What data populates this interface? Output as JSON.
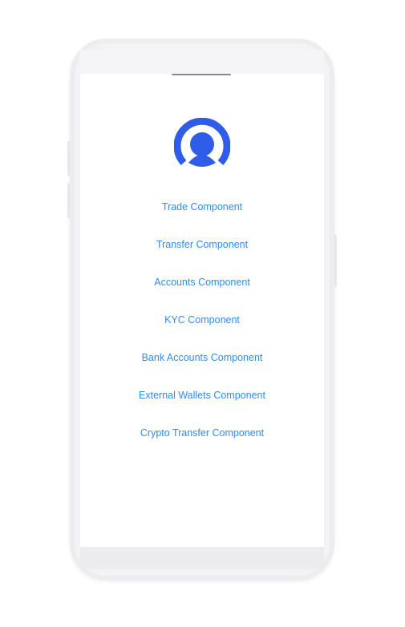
{
  "app": {
    "logo": "user-ring-logo",
    "accent_color": "#2f5ce8",
    "link_color": "#2f8cf3"
  },
  "menu": {
    "items": [
      {
        "label": "Trade Component"
      },
      {
        "label": "Transfer Component"
      },
      {
        "label": "Accounts Component"
      },
      {
        "label": "KYC Component"
      },
      {
        "label": "Bank Accounts Component"
      },
      {
        "label": "External Wallets Component"
      },
      {
        "label": "Crypto Transfer Component"
      }
    ]
  }
}
